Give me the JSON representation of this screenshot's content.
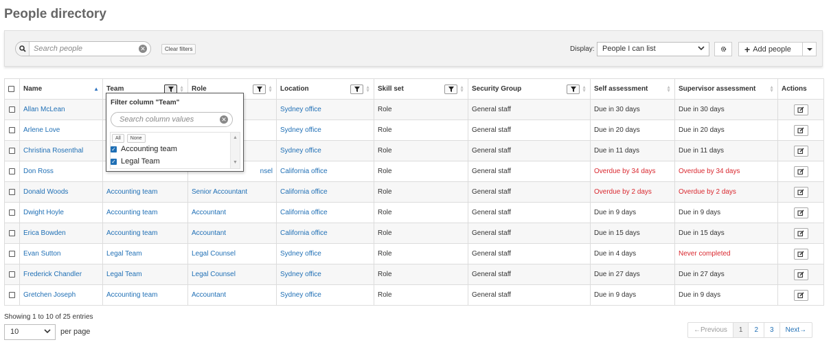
{
  "page": {
    "title": "People directory"
  },
  "toolbar": {
    "search_placeholder": "Search people",
    "clear_filters": "Clear filters",
    "display_label": "Display:",
    "display_value": "People I can list",
    "add_people": "Add people"
  },
  "columns": {
    "name": "Name",
    "team": "Team",
    "role": "Role",
    "location": "Location",
    "skill_set": "Skill set",
    "security_group": "Security Group",
    "self_assessment": "Self assessment",
    "supervisor_assessment": "Supervisor assessment",
    "actions": "Actions"
  },
  "rows": [
    {
      "name": "Allan McLean",
      "team": "",
      "role": "",
      "location": "Sydney office",
      "skill": "Role",
      "group": "General staff",
      "self": "Due in 30 days",
      "self_overdue": false,
      "sup": "Due in 30 days",
      "sup_overdue": false
    },
    {
      "name": "Arlene Love",
      "team": "",
      "role": "",
      "location": "Sydney office",
      "skill": "Role",
      "group": "General staff",
      "self": "Due in 20 days",
      "self_overdue": false,
      "sup": "Due in 20 days",
      "sup_overdue": false
    },
    {
      "name": "Christina Rosenthal",
      "team": "",
      "role": "",
      "location": "Sydney office",
      "skill": "Role",
      "group": "General staff",
      "self": "Due in 11 days",
      "self_overdue": false,
      "sup": "Due in 11 days",
      "sup_overdue": false
    },
    {
      "name": "Don Ross",
      "team": "",
      "role": "nsel",
      "location": "California office",
      "skill": "Role",
      "group": "General staff",
      "self": "Overdue by 34 days",
      "self_overdue": true,
      "sup": "Overdue by 34 days",
      "sup_overdue": true
    },
    {
      "name": "Donald Woods",
      "team": "Accounting team",
      "role": "Senior Accountant",
      "location": "California office",
      "skill": "Role",
      "group": "General staff",
      "self": "Overdue by 2 days",
      "self_overdue": true,
      "sup": "Overdue by 2 days",
      "sup_overdue": true
    },
    {
      "name": "Dwight Hoyle",
      "team": "Accounting team",
      "role": "Accountant",
      "location": "California office",
      "skill": "Role",
      "group": "General staff",
      "self": "Due in 9 days",
      "self_overdue": false,
      "sup": "Due in 9 days",
      "sup_overdue": false
    },
    {
      "name": "Erica Bowden",
      "team": "Accounting team",
      "role": "Accountant",
      "location": "California office",
      "skill": "Role",
      "group": "General staff",
      "self": "Due in 15 days",
      "self_overdue": false,
      "sup": "Due in 15 days",
      "sup_overdue": false
    },
    {
      "name": "Evan Sutton",
      "team": "Legal Team",
      "role": "Legal Counsel",
      "location": "Sydney office",
      "skill": "Role",
      "group": "General staff",
      "self": "Due in 4 days",
      "self_overdue": false,
      "sup": "Never completed",
      "sup_overdue": true
    },
    {
      "name": "Frederick Chandler",
      "team": "Legal Team",
      "role": "Legal Counsel",
      "location": "Sydney office",
      "skill": "Role",
      "group": "General staff",
      "self": "Due in 27 days",
      "self_overdue": false,
      "sup": "Due in 27 days",
      "sup_overdue": false
    },
    {
      "name": "Gretchen Joseph",
      "team": "Accounting team",
      "role": "Accountant",
      "location": "Sydney office",
      "skill": "Role",
      "group": "General staff",
      "self": "Due in 9 days",
      "self_overdue": false,
      "sup": "Due in 9 days",
      "sup_overdue": false
    }
  ],
  "filter_dropdown": {
    "title": "Filter column \"Team\"",
    "search_placeholder": "Search column values",
    "all": "All",
    "none": "None",
    "options": [
      {
        "label": "Accounting team",
        "checked": true
      },
      {
        "label": "Legal Team",
        "checked": true
      }
    ]
  },
  "footer": {
    "entries": "Showing 1 to 10 of 25 entries",
    "per_page_value": "10",
    "per_page_label": "per page",
    "prev": "←Previous",
    "pages": [
      "1",
      "2",
      "3"
    ],
    "next": "Next→"
  },
  "colors": {
    "link": "#1f6fb5",
    "overdue": "#d9282f"
  }
}
